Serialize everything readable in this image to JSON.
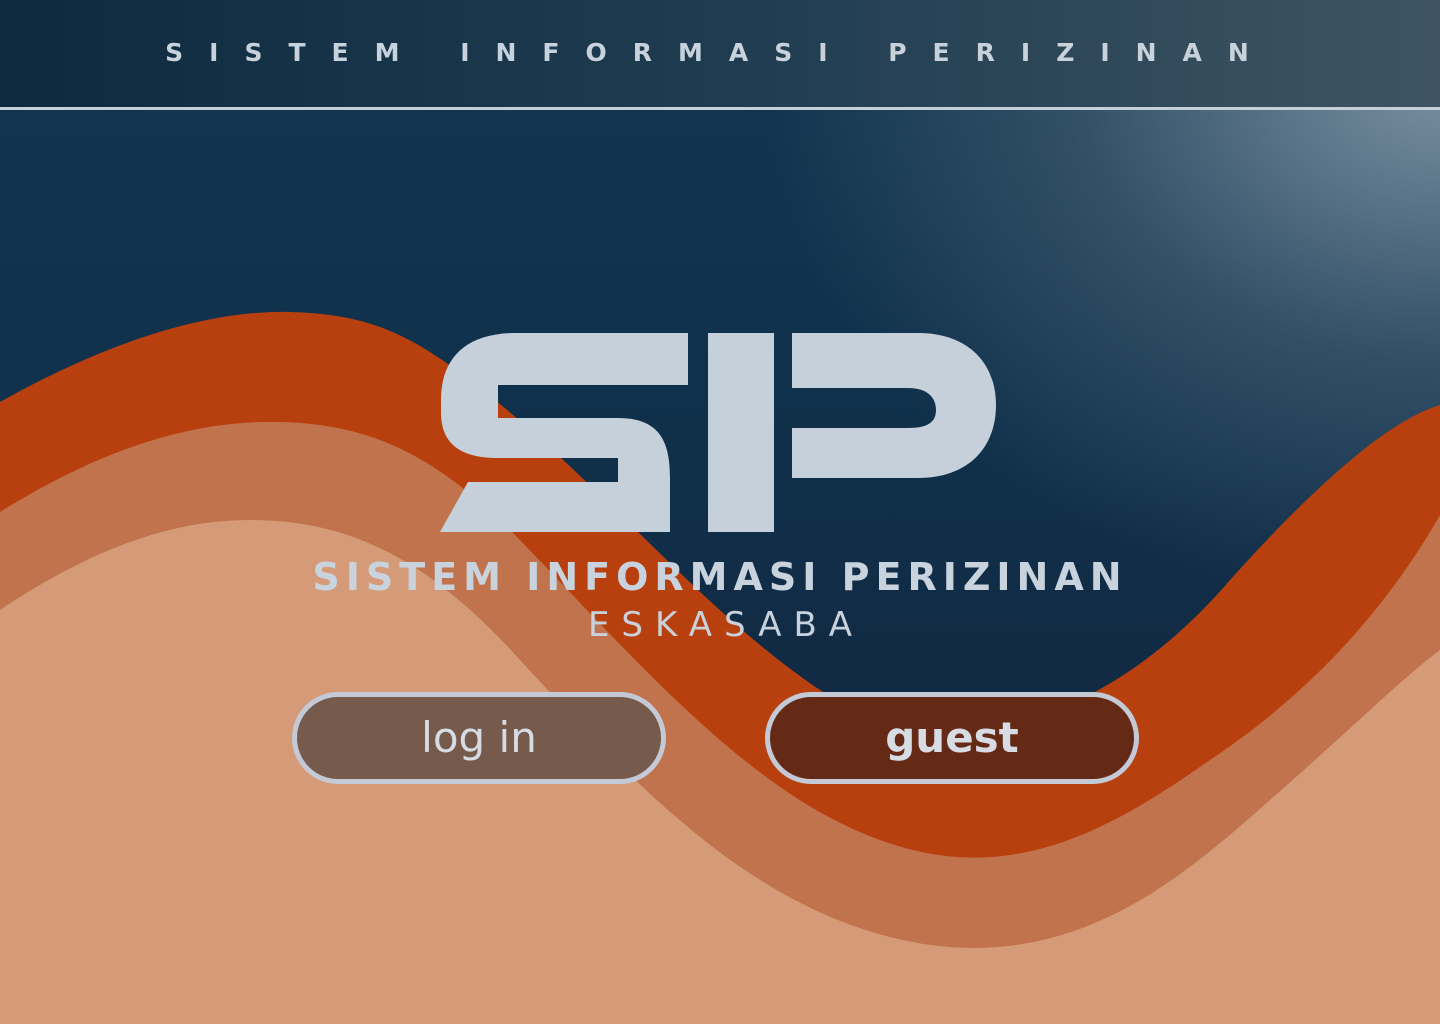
{
  "header": {
    "title": "SISTEM INFORMASI PERIZINAN"
  },
  "main": {
    "logo_text": "SIP",
    "title": "SISTEM INFORMASI PERIZINAN",
    "subtitle": "ESKASABA",
    "buttons": {
      "login_label": "log in",
      "guest_label": "guest"
    }
  },
  "colors": {
    "header_bg": "#0d2a3e",
    "background_dark": "#10304a",
    "wave_dark_orange": "#b8400f",
    "wave_mid_orange": "#c0734c",
    "wave_light_peach": "#d59b78",
    "logo": "#c5d0db",
    "login_button_bg": "#765a4c",
    "guest_button_bg": "#652a15",
    "button_border": "#c3cad6"
  }
}
